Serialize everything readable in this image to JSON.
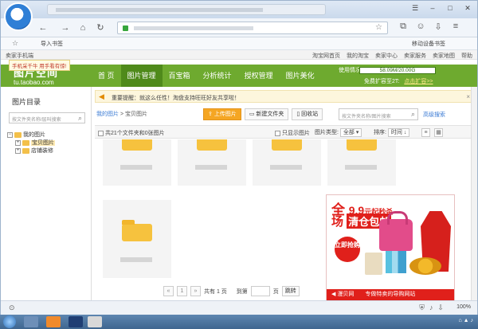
{
  "browser": {
    "bookmark_import": "导入书签",
    "mobile_bookmarks": "移动设备书签"
  },
  "site_topbar": {
    "seller_mobile": "卖家手机端",
    "tooltip": "手机采千牛 用手看有惊!",
    "links": [
      "淘宝网首页",
      "我的淘宝",
      "卖家中心",
      "卖家服务",
      "卖家地图",
      "帮助"
    ]
  },
  "header": {
    "brand_cn": "图片空间",
    "brand_en": "tu.taobao.com",
    "menu": [
      "首 页",
      "图片管理",
      "百宝箱",
      "分析统计",
      "授权管理",
      "图片美化"
    ],
    "active_menu": "图片管理",
    "quota_label": "使用情况:",
    "quota_value": "58.09M/20.00G",
    "quota_fill": 0.003,
    "free_label": "免费扩容至2T:",
    "free_link": "点击扩容>>"
  },
  "sidebar": {
    "title": "图片目录",
    "search_placeholder": "按文件夹名称/层叫搜索",
    "tree": {
      "root": "我的图片",
      "children": [
        "宝贝图片",
        "店铺装修"
      ]
    }
  },
  "notice": {
    "text": "重要提醒：就这么任性！淘盘支持旺旺好友共享啦！"
  },
  "toolbar": {
    "breadcrumb_home": "我的图片",
    "breadcrumb_sep": ">",
    "breadcrumb_current": "宝贝图片",
    "upload": "上传图片",
    "new_folder": "新建文件夹",
    "recycle": "回收站",
    "search_placeholder": "按文件夹名称/图片搜索",
    "advanced": "高级搜索"
  },
  "filter": {
    "count_text": "共21个文件夹和0张图片",
    "only_images": "只显示图片",
    "type_label": "图片类型:",
    "type_value": "全部",
    "sort_label": "排序:",
    "sort_value": "时间"
  },
  "pager": {
    "prev": "«",
    "current": "1",
    "next": "»",
    "total": "共有 1 页",
    "goto": "到第",
    "page_unit": "页",
    "jump": "跳转"
  },
  "ad": {
    "price_prefix": "全",
    "price_big": "9.9",
    "price_suffix": "元起秒杀",
    "line2_prefix": "场",
    "line2_hl": "清仓包邮",
    "badge": "立即抢购",
    "brand": "漫贝网",
    "tagline": "专做特卖的导购网站"
  },
  "statusbar": {
    "zoom": "100%"
  }
}
